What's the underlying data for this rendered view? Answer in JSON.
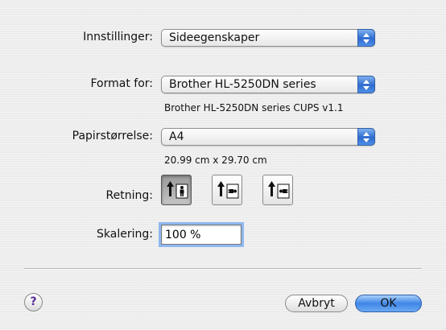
{
  "settings": {
    "label": "Innstillinger:",
    "value": "Sideegenskaper"
  },
  "format_for": {
    "label": "Format for:",
    "value": "Brother HL-5250DN series",
    "info": "Brother HL-5250DN series CUPS v1.1"
  },
  "paper_size": {
    "label": "Papirstørrelse:",
    "value": "A4",
    "info": "20.99 cm x 29.70 cm"
  },
  "orientation": {
    "label": "Retning:",
    "options": [
      {
        "name": "portrait",
        "selected": true
      },
      {
        "name": "landscape-left",
        "selected": false
      },
      {
        "name": "landscape-right",
        "selected": false
      }
    ]
  },
  "scaling": {
    "label": "Skalering:",
    "value": "100 %"
  },
  "buttons": {
    "help": "?",
    "cancel": "Avbryt",
    "ok": "OK"
  },
  "colors": {
    "accent": "#3f86e6",
    "help_glyph": "#5a2a9a"
  }
}
